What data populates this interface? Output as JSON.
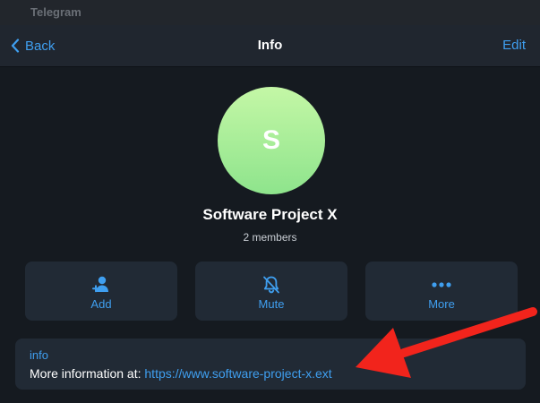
{
  "window": {
    "title": "Telegram"
  },
  "navbar": {
    "back_label": "Back",
    "title": "Info",
    "edit_label": "Edit"
  },
  "group": {
    "avatar_letter": "S",
    "name": "Software Project X",
    "members": "2 members"
  },
  "actions": [
    {
      "label": "Add",
      "icon": "add-user-icon"
    },
    {
      "label": "Mute",
      "icon": "bell-muted-icon"
    },
    {
      "label": "More",
      "icon": "ellipsis-icon"
    }
  ],
  "info": {
    "heading": "info",
    "text_prefix": "More information at: ",
    "link": "https://www.software-project-x.ext"
  },
  "colors": {
    "accent": "#3f9ff0",
    "background": "#151a20",
    "card": "#212a35",
    "avatar_top": "#c4f7a6",
    "avatar_bottom": "#8ee48c",
    "annotation_arrow": "#f2241c"
  }
}
